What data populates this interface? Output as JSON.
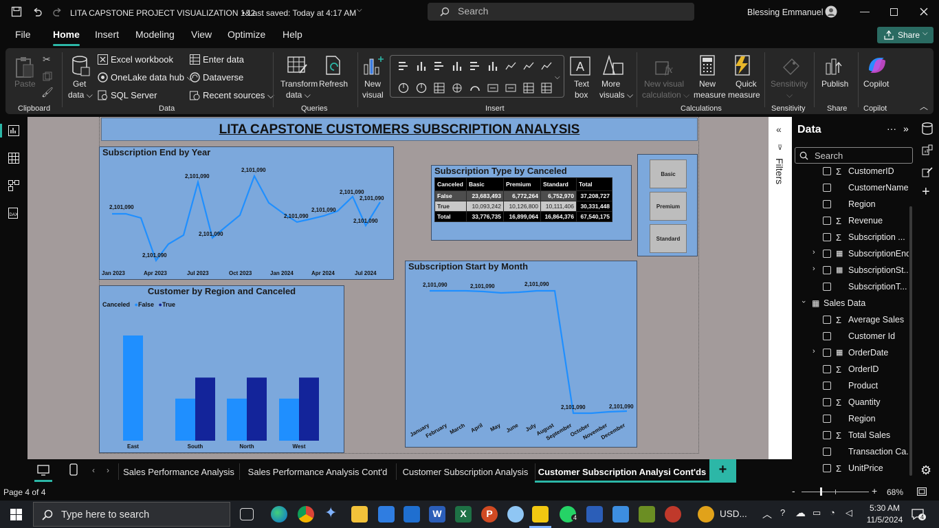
{
  "window": {
    "title": "LITA CAPSTONE PROJECT VISUALIZATION 1&2",
    "saved": "Last saved: Today at 4:17 AM",
    "search_placeholder": "Search",
    "user": "Blessing Emmanuel"
  },
  "menu": {
    "items": [
      "File",
      "Home",
      "Insert",
      "Modeling",
      "View",
      "Optimize",
      "Help"
    ],
    "active": "Home",
    "share": "Share"
  },
  "ribbon": {
    "paste": "Paste",
    "get_data": [
      "Get",
      "data"
    ],
    "excel": "Excel workbook",
    "onelake": "OneLake data hub",
    "sql": "SQL Server",
    "enter_data": "Enter data",
    "dataverse": "Dataverse",
    "recent": "Recent sources",
    "transform": [
      "Transform",
      "data"
    ],
    "refresh": "Refresh",
    "new_visual": [
      "New",
      "visual"
    ],
    "text_box": [
      "Text",
      "box"
    ],
    "more_visuals": [
      "More",
      "visuals"
    ],
    "new_calc": [
      "New visual",
      "calculation"
    ],
    "new_measure": [
      "New",
      "measure"
    ],
    "quick_measure": [
      "Quick",
      "measure"
    ],
    "sensitivity": "Sensitivity",
    "publish": "Publish",
    "copilot": "Copilot",
    "groups": [
      "Clipboard",
      "Data",
      "Queries",
      "Insert",
      "Calculations",
      "Sensitivity",
      "Share",
      "Copilot"
    ]
  },
  "report": {
    "title": "LITA CAPSTONE CUSTOMERS SUBSCRIPTION ANALYSIS",
    "slicer": [
      "Basic",
      "Premium",
      "Standard"
    ]
  },
  "chart_data": [
    {
      "type": "line",
      "title": "Subscription End by Year",
      "x_ticks": [
        "Jan 2023",
        "Apr 2023",
        "Jul 2023",
        "Oct 2023",
        "Jan 2024",
        "Apr 2024",
        "Jul 2024"
      ],
      "data_labels": [
        "2,101,090",
        "2,101,090",
        "2,101,090",
        "2,101,090",
        "2,101,090",
        "2,101,090",
        "2,101,090",
        "2,101,090",
        "2,101,090",
        "2,101,090"
      ]
    },
    {
      "type": "table",
      "title": "Subscription Type by Canceled",
      "columns": [
        "Canceled",
        "Basic",
        "Premium",
        "Standard",
        "Total"
      ],
      "rows": [
        [
          "False",
          "23,683,493",
          "6,772,264",
          "6,752,970",
          "37,208,727"
        ],
        [
          "True",
          "10,093,242",
          "10,126,800",
          "10,111,406",
          "30,331,448"
        ],
        [
          "Total",
          "33,776,735",
          "16,899,064",
          "16,864,376",
          "67,540,175"
        ]
      ]
    },
    {
      "type": "bar",
      "title": "Customer by Region and Canceled",
      "legend_title": "Canceled",
      "categories": [
        "East",
        "South",
        "North",
        "West"
      ],
      "series": [
        {
          "name": "False",
          "values": [
            1.0,
            0.4,
            0.4,
            0.4
          ],
          "color": "#1f8fff"
        },
        {
          "name": "True",
          "values": [
            0,
            0.6,
            0.6,
            0.6
          ],
          "color": "#13249a"
        }
      ]
    },
    {
      "type": "line",
      "title": "Subscription Start by Month",
      "categories": [
        "January",
        "February",
        "March",
        "April",
        "May",
        "June",
        "July",
        "August",
        "September",
        "October",
        "November",
        "December"
      ],
      "data_labels": [
        "2,101,090",
        "2,101,090",
        "2,101,090",
        "2,101,090",
        "2,101,090"
      ]
    }
  ],
  "filters_label": "Filters",
  "data_pane": {
    "title": "Data",
    "search_placeholder": "Search",
    "fields": [
      {
        "name": "CustomerID",
        "sigma": true
      },
      {
        "name": "CustomerName",
        "sigma": false
      },
      {
        "name": "Region",
        "sigma": false
      },
      {
        "name": "Revenue",
        "sigma": true
      },
      {
        "name": "Subscription ...",
        "sigma": true
      },
      {
        "name": "SubscriptionEnd",
        "sigma": false,
        "expand": true,
        "cal": true
      },
      {
        "name": "SubscriptionSt...",
        "sigma": false,
        "expand": true,
        "cal": true
      },
      {
        "name": "SubscriptionT...",
        "sigma": false
      }
    ],
    "table2": "Sales Data",
    "fields2": [
      {
        "name": "Average Sales",
        "sigma": true
      },
      {
        "name": "Customer Id",
        "sigma": false
      },
      {
        "name": "OrderDate",
        "sigma": false,
        "expand": true,
        "cal": true
      },
      {
        "name": "OrderID",
        "sigma": true
      },
      {
        "name": "Product",
        "sigma": false
      },
      {
        "name": "Quantity",
        "sigma": true
      },
      {
        "name": "Region",
        "sigma": false
      },
      {
        "name": "Total Sales",
        "sigma": true
      },
      {
        "name": "Transaction Ca...",
        "sigma": false
      },
      {
        "name": "UnitPrice",
        "sigma": true
      }
    ]
  },
  "tabs": [
    "Sales Performance Analysis",
    "Sales Performance Analysis Cont'd",
    "Customer Subscription Analysis",
    "Customer Subscription Analysi Cont'ds"
  ],
  "status": {
    "page": "Page 4 of 4",
    "zoom": "68%"
  },
  "taskbar": {
    "search": "Type here to search",
    "usd": "USD...",
    "time": "5:30 AM",
    "date": "11/5/2024",
    "notif": "4"
  }
}
